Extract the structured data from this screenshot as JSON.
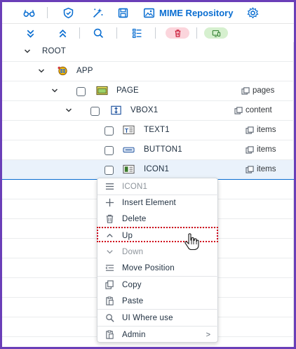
{
  "toolbar": {
    "mime_label": "MIME Repository",
    "icons": [
      "glasses-icon",
      "shield-icon",
      "magic-wand-icon",
      "save-icon",
      "image-icon",
      "gear-icon"
    ]
  },
  "toolbar2": {
    "icons": [
      "collapse-all-icon",
      "expand-all-icon",
      "search-icon",
      "list-icon",
      "delete-icon",
      "screen-icon"
    ],
    "colors": {
      "delete_pill": "#fbd5dc",
      "screen_pill": "#d6f0cf"
    }
  },
  "tree": {
    "rows": [
      {
        "label": "ROOT",
        "relation": ""
      },
      {
        "label": "APP",
        "relation": ""
      },
      {
        "label": "PAGE",
        "relation": "pages"
      },
      {
        "label": "VBOX1",
        "relation": "content"
      },
      {
        "label": "TEXT1",
        "relation": "items"
      },
      {
        "label": "BUTTON1",
        "relation": "items"
      },
      {
        "label": "ICON1",
        "relation": "items"
      }
    ]
  },
  "context_menu": {
    "header": "ICON1",
    "items": [
      {
        "label": "Insert Element",
        "icon": "plus-icon"
      },
      {
        "label": "Delete",
        "icon": "trash-icon"
      },
      {
        "label": "Up",
        "icon": "chevron-up-icon"
      },
      {
        "label": "Down",
        "icon": "chevron-down-icon"
      },
      {
        "label": "Move Position",
        "icon": "move-icon"
      },
      {
        "label": "Copy",
        "icon": "copy-icon"
      },
      {
        "label": "Paste",
        "icon": "paste-icon"
      },
      {
        "label": "UI Where use",
        "icon": "search-icon"
      },
      {
        "label": "Admin",
        "icon": "admin-icon"
      }
    ],
    "admin_arrow": ">"
  },
  "colors": {
    "accent": "#0a6ed1",
    "frame": "#6a3fb8",
    "highlight": "#d0021b"
  }
}
